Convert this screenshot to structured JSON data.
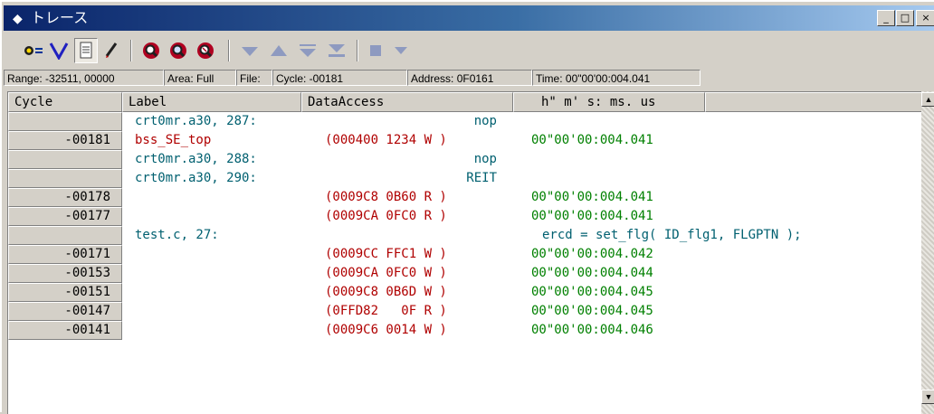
{
  "window": {
    "title": "トレース",
    "buttons": {
      "minimize": "_",
      "maximize": "□",
      "close": "×"
    }
  },
  "toolbar": {
    "icons": [
      "trace-icon",
      "filter-icon",
      "document-icon",
      "pencil-icon",
      "search-red-icon",
      "search-blue-icon",
      "search-clear-icon",
      "down-triangle-icon",
      "up-triangle-icon",
      "step-down-icon",
      "step-end-icon",
      "stop-square-icon",
      "down-arrow-icon"
    ]
  },
  "status": {
    "range": "Range: -32511,  00000",
    "area": "Area: Full",
    "file": "File:",
    "cycle": "Cycle: -00181",
    "address": "Address: 0F0161",
    "time": "Time: 00\"00'00:004.041"
  },
  "table": {
    "headers": {
      "cycle": "Cycle",
      "label": "Label",
      "access": "DataAccess",
      "time": "h\" m' s: ms. us"
    },
    "rows": [
      {
        "cycle": "",
        "label": "crt0mr.a30, 287:",
        "access": "",
        "source": "nop",
        "time": ""
      },
      {
        "cycle": "-00181",
        "label": "bss_SE_top",
        "access": "(000400 1234 W )",
        "source": "",
        "time": "00\"00'00:004.041"
      },
      {
        "cycle": "",
        "label": "crt0mr.a30, 288:",
        "access": "",
        "source": "nop",
        "time": ""
      },
      {
        "cycle": "",
        "label": "crt0mr.a30, 290:",
        "access": "",
        "source": "REIT",
        "time": ""
      },
      {
        "cycle": "-00178",
        "label": "",
        "access": "(0009C8 0B60 R )",
        "source": "",
        "time": "00\"00'00:004.041"
      },
      {
        "cycle": "-00177",
        "label": "",
        "access": "(0009CA 0FC0 R )",
        "source": "",
        "time": "00\"00'00:004.041"
      },
      {
        "cycle": "",
        "label": "test.c, 27:",
        "access": "",
        "source": "ercd = set_flg( ID_flg1, FLGPTN );",
        "time": ""
      },
      {
        "cycle": "-00171",
        "label": "",
        "access": "(0009CC FFC1 W )",
        "source": "",
        "time": "00\"00'00:004.042"
      },
      {
        "cycle": "-00153",
        "label": "",
        "access": "(0009CA 0FC0 W )",
        "source": "",
        "time": "00\"00'00:004.044"
      },
      {
        "cycle": "-00151",
        "label": "",
        "access": "(0009C8 0B6D W )",
        "source": "",
        "time": "00\"00'00:004.045"
      },
      {
        "cycle": "-00147",
        "label": "",
        "access": "(0FFD82   0F R )",
        "source": "",
        "time": "00\"00'00:004.045"
      },
      {
        "cycle": "-00141",
        "label": "",
        "access": "(0009C6 0014 W )",
        "source": "",
        "time": "00\"00'00:004.046"
      }
    ]
  },
  "scrollbar": {
    "up": "▲",
    "down": "▼"
  }
}
